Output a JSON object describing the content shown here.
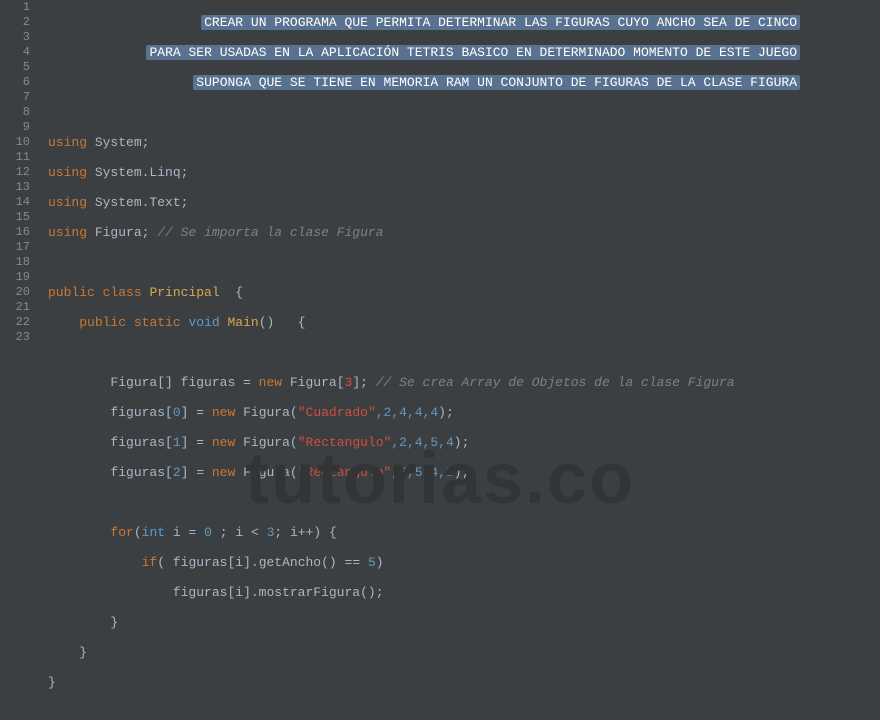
{
  "header": {
    "line1": "CREAR UN PROGRAMA QUE PERMITA DETERMINAR LAS FIGURAS CUYO ANCHO SEA DE CINCO",
    "line2": "PARA SER USADAS EN LA APLICACIÓN TETRIS BASICO EN DETERMINADO MOMENTO DE ESTE JUEGO",
    "line3": "SUPONGA QUE SE TIENE EN MEMORIA RAM UN CONJUNTO DE FIGURAS DE LA CLASE FIGURA"
  },
  "lineNumbers": [
    "1",
    "2",
    "3",
    "4",
    "5",
    "6",
    "7",
    "8",
    "9",
    "10",
    "11",
    "12",
    "13",
    "14",
    "15",
    "16",
    "17",
    "18",
    "19",
    "20",
    "21",
    "22",
    "23"
  ],
  "code": {
    "using": "using",
    "ns_system": "System;",
    "ns_linq": "System.Linq;",
    "ns_text": "System.Text;",
    "ns_figura": "Figura;",
    "comment_import": "// Se importa la clase Figura",
    "public": "public",
    "class": "class",
    "classname": "Principal",
    "static": "static",
    "void": "void",
    "main": "Main",
    "figura_type": "Figura",
    "figuras_var": "figuras",
    "new": "new",
    "num3": "3",
    "comment_array": "// Se crea Array de Objetos de la clase Figura",
    "idx0": "0",
    "idx1": "1",
    "idx2": "2",
    "str_cuadrado": "\"Cuadrado\"",
    "str_rect1": "\"Rectangulo\"",
    "str_rect2": "\"Rectangulo\"",
    "args0": ",2,4,4,4",
    "args1": ",2,4,5,4",
    "args2": ",5,5,4,2",
    "for": "for",
    "int": "int",
    "i": "i",
    "eq": "=",
    "zero": "0",
    "lt": "<",
    "three": "3",
    "inc": "i++",
    "if": "if",
    "getAncho": "getAncho",
    "eqeq": "==",
    "five": "5",
    "mostrar": "mostrarFigura"
  },
  "watermark": "tutorias.co"
}
